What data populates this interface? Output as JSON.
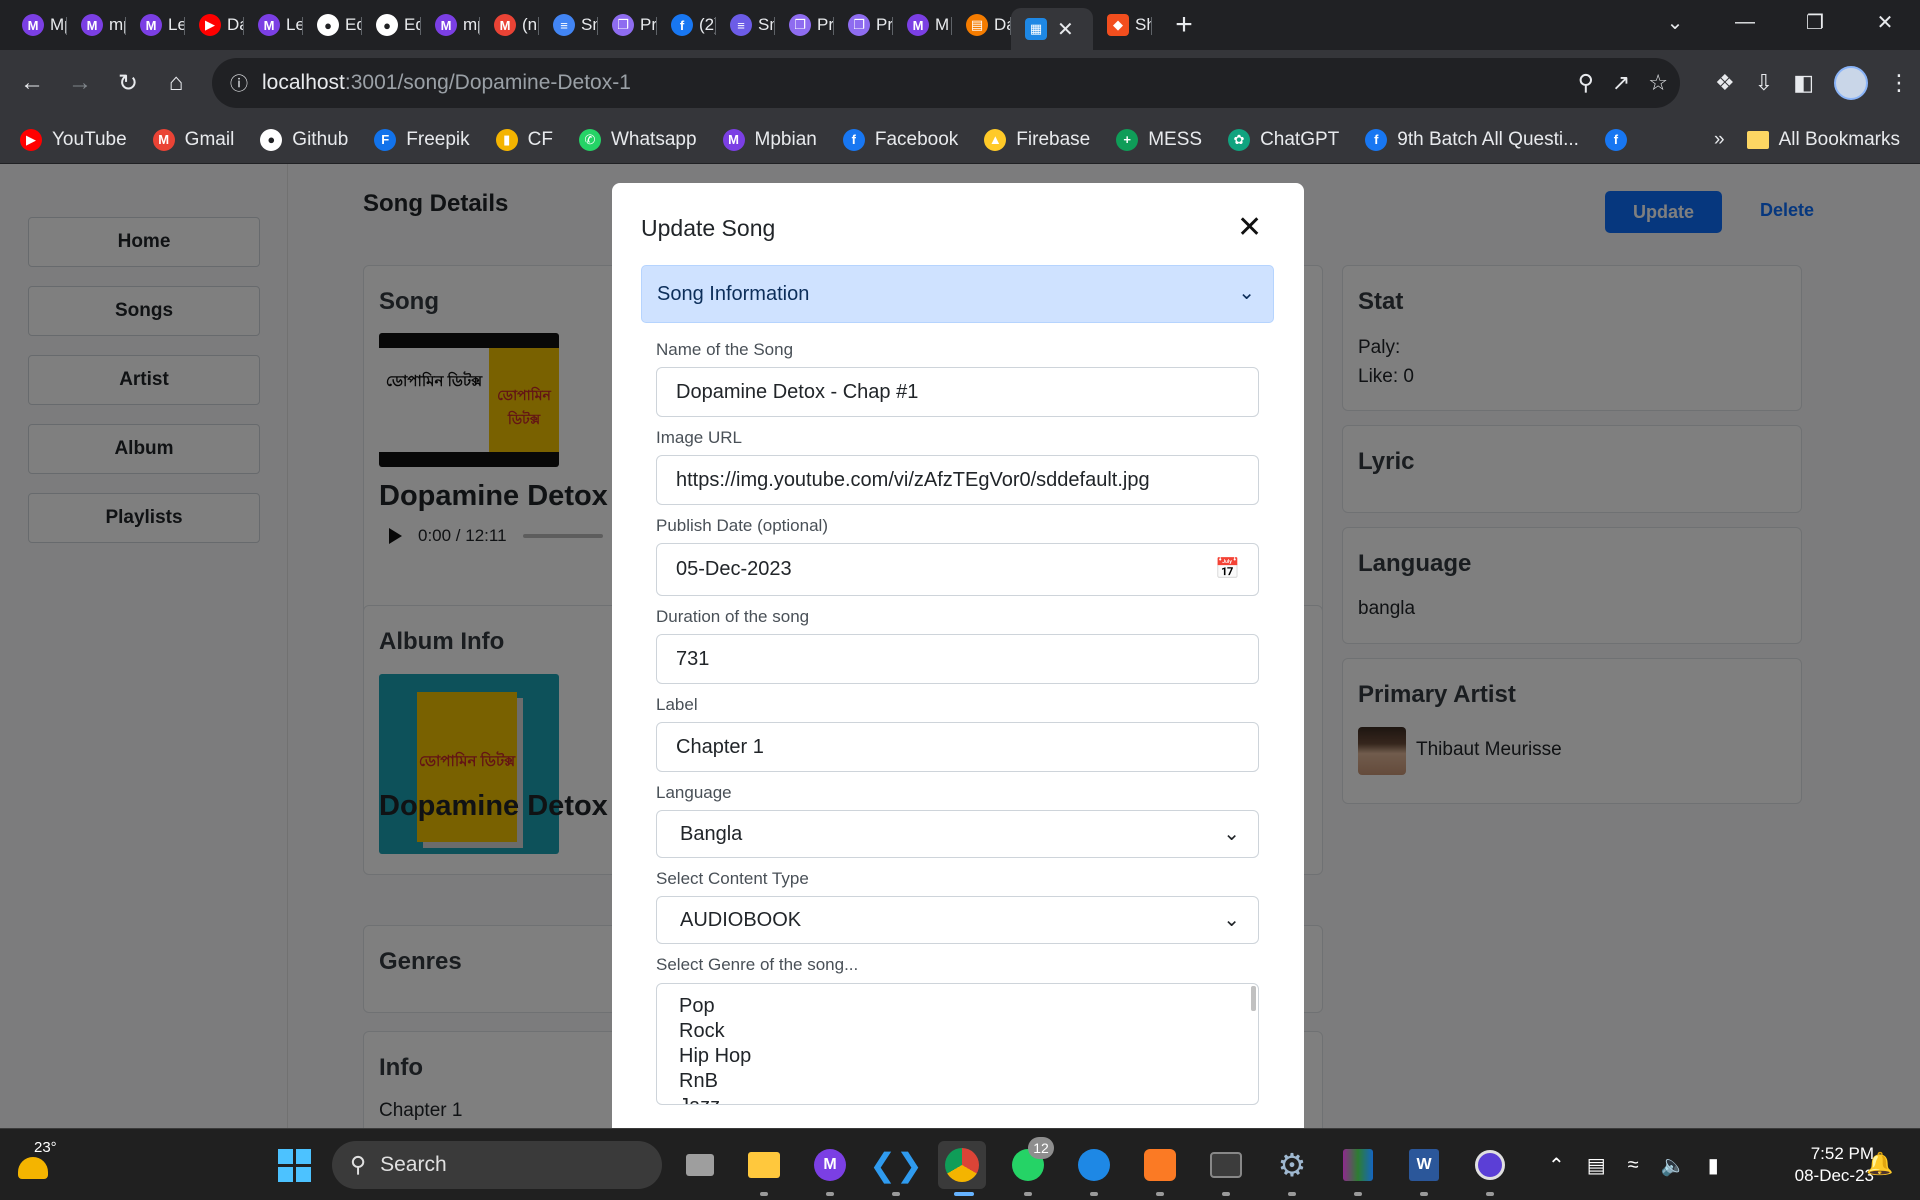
{
  "browser": {
    "tabs": [
      {
        "label": "Mp",
        "icon": "m-icon",
        "color": "#7b3fe4"
      },
      {
        "label": "mp",
        "icon": "m-icon",
        "color": "#7b3fe4"
      },
      {
        "label": "Le",
        "icon": "m-icon",
        "color": "#7b3fe4"
      },
      {
        "label": "Da",
        "icon": "youtube-icon",
        "color": "#ff0000"
      },
      {
        "label": "Le",
        "icon": "m-icon",
        "color": "#7b3fe4"
      },
      {
        "label": "Ed",
        "icon": "github-icon",
        "color": "#ffffff"
      },
      {
        "label": "Ed",
        "icon": "github-icon",
        "color": "#ffffff"
      },
      {
        "label": "mp",
        "icon": "m-icon",
        "color": "#7b3fe4"
      },
      {
        "label": "(n",
        "icon": "gmail-icon",
        "color": "#ea4335"
      },
      {
        "label": "Sm",
        "icon": "docs-icon",
        "color": "#4285f4"
      },
      {
        "label": "Pri",
        "icon": "copy-icon",
        "color": "#8e6cf0"
      },
      {
        "label": "(2)",
        "icon": "facebook-icon",
        "color": "#1877f2"
      },
      {
        "label": "Sm",
        "icon": "list-icon",
        "color": "#6c5ce7"
      },
      {
        "label": "Pri",
        "icon": "copy-icon",
        "color": "#8e6cf0"
      },
      {
        "label": "Pri",
        "icon": "copy-icon",
        "color": "#8e6cf0"
      },
      {
        "label": "M",
        "icon": "m-icon",
        "color": "#7b3fe4"
      },
      {
        "label": "Da",
        "icon": "chat-icon",
        "color": "#f57c00"
      }
    ],
    "active_tab": {
      "icon": "app-icon",
      "color": "#1e88e5"
    },
    "after_tab": {
      "label": "Sh",
      "icon": "figma-icon",
      "color": "#f24e1e"
    },
    "url_host": "localhost",
    "url_path": ":3001/song/Dopamine-Detox-1",
    "bookmarks": [
      {
        "label": "YouTube",
        "icon": "youtube-icon",
        "color": "#ff0000"
      },
      {
        "label": "Gmail",
        "icon": "gmail-icon",
        "color": "#ea4335"
      },
      {
        "label": "Github",
        "icon": "github-icon",
        "color": "#ffffff"
      },
      {
        "label": "Freepik",
        "icon": "freepik-icon",
        "color": "#1273eb"
      },
      {
        "label": "CF",
        "icon": "codeforces-icon",
        "color": "#f4b400"
      },
      {
        "label": "Whatsapp",
        "icon": "whatsapp-icon",
        "color": "#25d366"
      },
      {
        "label": "Mpbian",
        "icon": "m-icon",
        "color": "#7b3fe4"
      },
      {
        "label": "Facebook",
        "icon": "facebook-icon",
        "color": "#1877f2"
      },
      {
        "label": "Firebase",
        "icon": "firebase-icon",
        "color": "#ffca28"
      },
      {
        "label": "MESS",
        "icon": "sheets-icon",
        "color": "#0f9d58"
      },
      {
        "label": "ChatGPT",
        "icon": "chatgpt-icon",
        "color": "#10a37f"
      },
      {
        "label": "9th Batch All Questi...",
        "icon": "facebook-icon",
        "color": "#1877f2"
      }
    ],
    "all_bookmarks": "All Bookmarks",
    "overflow": "»"
  },
  "sidebar": {
    "items": [
      "Home",
      "Songs",
      "Artist",
      "Album",
      "Playlists"
    ]
  },
  "page": {
    "title": "Song Details",
    "update_label": "Update",
    "delete_label": "Delete",
    "song_card_title": "Song",
    "song_name": "Dopamine Detox",
    "player_time": "0:00 / 12:11",
    "album_card_title": "Album Info",
    "album_name": "Dopamine Detox",
    "genres_title": "Genres",
    "info_title": "Info",
    "info_text": "Chapter 1",
    "cover_text_left": "ডোপামিন ডিটক্স",
    "cover_text_right": "ডোপামিন ডিটক্স",
    "stat_title": "Stat",
    "stat_play": "Paly:",
    "stat_like": "Like: 0",
    "lyric_title": "Lyric",
    "language_title": "Language",
    "language_value": "bangla",
    "artist_title": "Primary Artist",
    "artist_name": "Thibaut Meurisse"
  },
  "modal": {
    "title": "Update Song",
    "section": "Song Information",
    "fields": {
      "name_label": "Name of the Song",
      "name_value": "Dopamine Detox - Chap #1",
      "image_label": "Image URL",
      "image_value": "https://img.youtube.com/vi/zAfzTEgVor0/sddefault.jpg",
      "date_label": "Publish Date (optional)",
      "date_value": "05-Dec-2023",
      "duration_label": "Duration of the song",
      "duration_value": "731",
      "label_label": "Label",
      "label_value": "Chapter 1",
      "language_label": "Language",
      "language_value": "Bangla",
      "content_label": "Select Content Type",
      "content_value": "AUDIOBOOK",
      "genre_label": "Select Genre of the song...",
      "genre_options": [
        "Pop",
        "Rock",
        "Hip Hop",
        "RnB",
        "Jazz"
      ]
    }
  },
  "taskbar": {
    "weather_temp": "23°",
    "search_placeholder": "Search",
    "whatsapp_badge": "12",
    "time": "7:52 PM",
    "date": "08-Dec-23"
  }
}
